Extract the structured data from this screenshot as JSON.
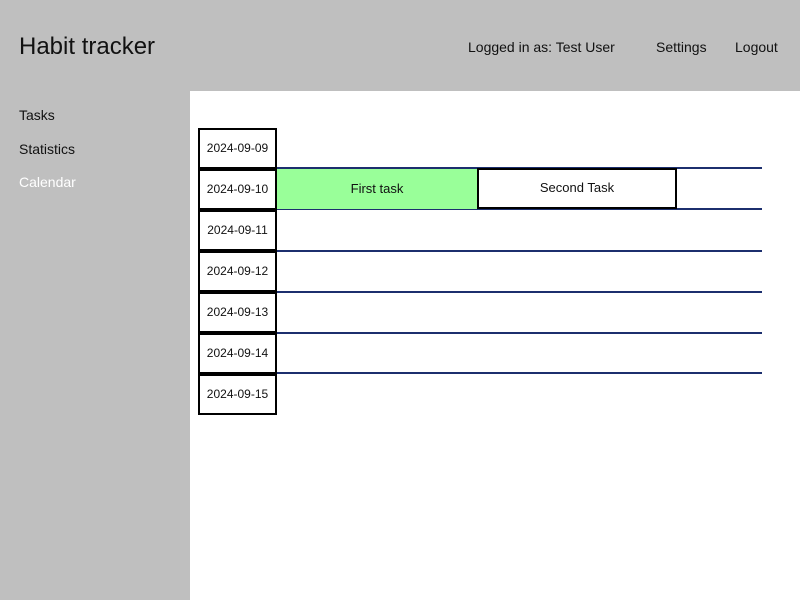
{
  "header": {
    "title": "Habit tracker",
    "user_label": "Logged in as: Test User",
    "settings_label": "Settings",
    "logout_label": "Logout"
  },
  "sidebar": {
    "items": [
      {
        "label": "Tasks",
        "active": false
      },
      {
        "label": "Statistics",
        "active": false
      },
      {
        "label": "Calendar",
        "active": true
      }
    ]
  },
  "calendar": {
    "dates": [
      "2024-09-09",
      "2024-09-10",
      "2024-09-11",
      "2024-09-12",
      "2024-09-13",
      "2024-09-14",
      "2024-09-15"
    ],
    "tasks": [
      {
        "label": "First task",
        "date": "2024-09-10",
        "color": "#99ff99"
      },
      {
        "label": "Second Task",
        "date": "2024-09-10",
        "color": "#ffffff"
      }
    ]
  },
  "colors": {
    "chrome_gray": "#bfbfbf",
    "row_line": "#1c2f6e",
    "completed_task": "#99ff99"
  }
}
